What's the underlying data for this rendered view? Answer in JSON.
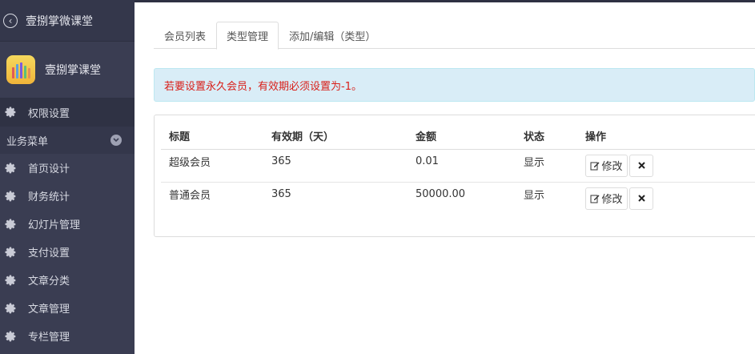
{
  "sidebar": {
    "header_title": "壹捌掌微课堂",
    "brand_name": "壹捌掌课堂",
    "top_item": "权限设置",
    "group_label": "业务菜单",
    "items": [
      {
        "label": "首页设计"
      },
      {
        "label": "财务统计"
      },
      {
        "label": "幻灯片管理"
      },
      {
        "label": "支付设置"
      },
      {
        "label": "文章分类"
      },
      {
        "label": "文章管理"
      },
      {
        "label": "专栏管理"
      }
    ]
  },
  "tabs": [
    {
      "label": "会员列表"
    },
    {
      "label": "类型管理"
    },
    {
      "label": "添加/编辑（类型）"
    }
  ],
  "alert": "若要设置永久会员，有效期必须设置为-1。",
  "table": {
    "headers": [
      "标题",
      "有效期（天）",
      "金额",
      "状态",
      "操作"
    ],
    "rows": [
      {
        "title": "超级会员",
        "period": "365",
        "amount": "0.01",
        "status": "显示",
        "edit": "修改"
      },
      {
        "title": "普通会员",
        "period": "365",
        "amount": "50000.00",
        "status": "显示",
        "edit": "修改"
      }
    ]
  },
  "colors": {
    "sidebar_bg": "#3a3d52",
    "alert_bg": "#d9edf7",
    "alert_text": "#d9201a"
  }
}
